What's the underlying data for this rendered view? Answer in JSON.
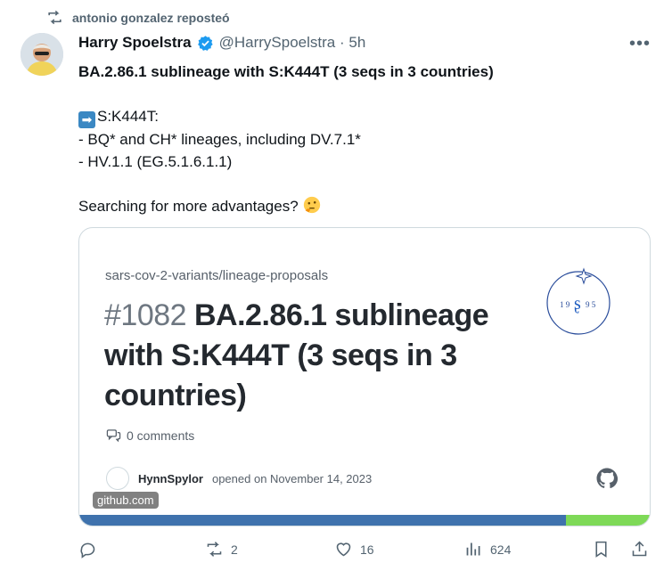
{
  "repost": {
    "text": "antonio gonzalez reposteó"
  },
  "author": {
    "name": "Harry Spoelstra",
    "handle_time": "@HarrySpoelstra · 5h"
  },
  "tweet": {
    "title": "BA.2.86.1 sublineage with S:K444T (3 seqs in 3 countries)",
    "line1": "S:K444T:",
    "line2": "- BQ* and CH* lineages, including DV.7.1*",
    "line3": "- HV.1.1 (EG.5.1.6.1.1)",
    "line4": "Searching for more advantages?"
  },
  "card": {
    "repo": "sars-cov-2-variants/lineage-proposals",
    "number": "#1082",
    "title": "BA.2.86.1 sublineage with S:K444T (3 seqs in 3 countries)",
    "comments": "0 comments",
    "author": "HynnSpylor",
    "opened": "opened on November 14, 2023",
    "domain": "github.com",
    "bar_colors": [
      "#3f72ad",
      "#7ed957"
    ]
  },
  "actions": {
    "replies": "",
    "reposts": "2",
    "likes": "16",
    "views": "624"
  }
}
